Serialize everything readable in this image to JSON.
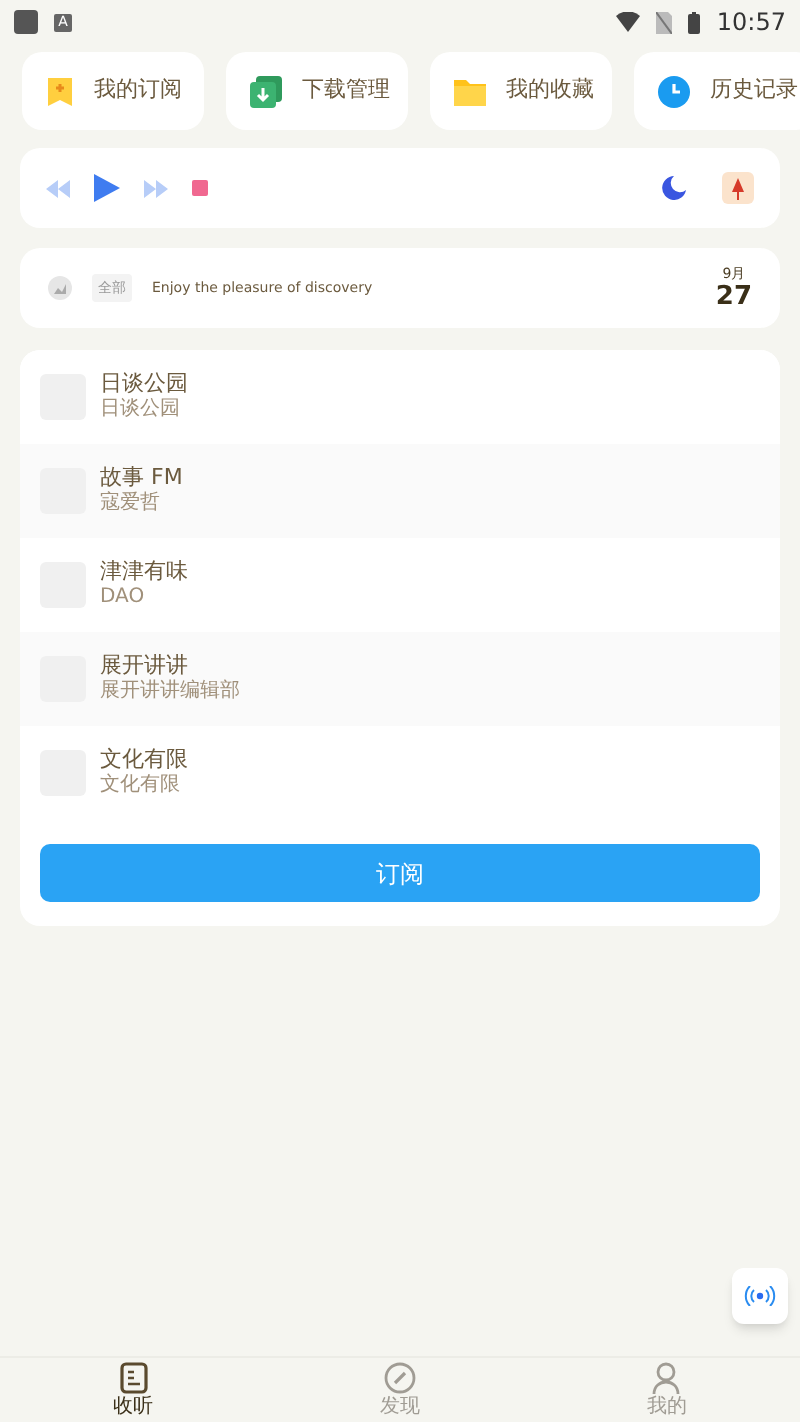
{
  "status_bar": {
    "notification_badge": "A",
    "time": "10:57"
  },
  "shortcuts": [
    {
      "label": "我的订阅",
      "kind": "bookmark"
    },
    {
      "label": "下载管理",
      "kind": "download"
    },
    {
      "label": "我的收藏",
      "kind": "folder"
    },
    {
      "label": "历史记录",
      "kind": "clock"
    }
  ],
  "banner": {
    "tag": "全部",
    "text": "Enjoy the pleasure of discovery",
    "month": "9月",
    "day": "27"
  },
  "channels": [
    {
      "title": "日谈公园",
      "subtitle": "日谈公园"
    },
    {
      "title": "故事 FM",
      "subtitle": "寇爱哲"
    },
    {
      "title": "津津有味",
      "subtitle": "DAO"
    },
    {
      "title": "展开讲讲",
      "subtitle": "展开讲讲编辑部"
    },
    {
      "title": "文化有限",
      "subtitle": "文化有限"
    }
  ],
  "subscribe_button": "订阅",
  "bottom_nav": [
    {
      "label": "收听",
      "kind": "listen",
      "selected": true
    },
    {
      "label": "发现",
      "kind": "compass",
      "selected": false
    },
    {
      "label": "我的",
      "kind": "person",
      "selected": false
    }
  ]
}
